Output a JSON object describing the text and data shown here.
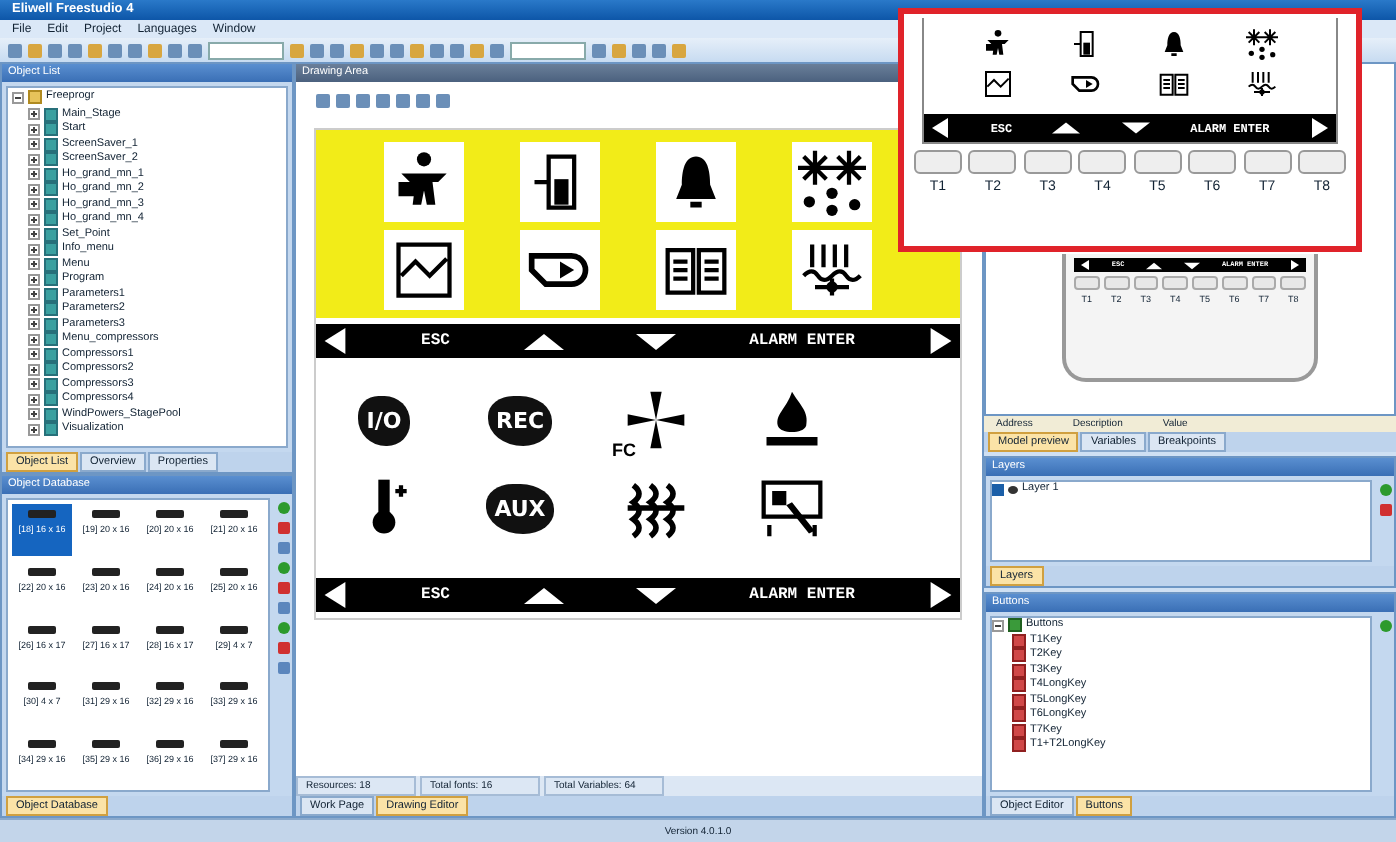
{
  "window": {
    "title": "Eliwell Freestudio 4"
  },
  "menu": [
    "File",
    "Edit",
    "Project",
    "Languages",
    "Window"
  ],
  "object_list": {
    "title": "Object List",
    "root": {
      "label": "Freeprogr",
      "expanded": true,
      "children": [
        {
          "label": "Main_Stage"
        },
        {
          "label": "Start"
        },
        {
          "label": "ScreenSaver_1"
        },
        {
          "label": "ScreenSaver_2"
        },
        {
          "label": "Ho_grand_mn_1"
        },
        {
          "label": "Ho_grand_mn_2"
        },
        {
          "label": "Ho_grand_mn_3"
        },
        {
          "label": "Ho_grand_mn_4"
        },
        {
          "label": "Set_Point"
        },
        {
          "label": "Info_menu"
        },
        {
          "label": "Menu"
        },
        {
          "label": "Program"
        },
        {
          "label": "Parameters1"
        },
        {
          "label": "Parameters2"
        },
        {
          "label": "Parameters3"
        },
        {
          "label": "Menu_compressors"
        },
        {
          "label": "Compressors1"
        },
        {
          "label": "Compressors2"
        },
        {
          "label": "Compressors3"
        },
        {
          "label": "Compressors4"
        },
        {
          "label": "WindPowers_StagePool"
        },
        {
          "label": "Visualization"
        }
      ]
    },
    "tabs": [
      {
        "label": "Object List",
        "selected": true
      },
      {
        "label": "Overview",
        "selected": false
      },
      {
        "label": "Properties",
        "selected": false
      }
    ]
  },
  "object_database": {
    "title": "Object Database",
    "items": [
      {
        "label": "[18] 16 x 16",
        "selected": true
      },
      {
        "label": "[19] 20 x 16",
        "selected": false
      },
      {
        "label": "[20] 20 x 16",
        "selected": false
      },
      {
        "label": "[21] 20 x 16",
        "selected": false
      },
      {
        "label": "[22] 20 x 16",
        "selected": false
      },
      {
        "label": "[23] 20 x 16",
        "selected": false
      },
      {
        "label": "[24] 20 x 16",
        "selected": false
      },
      {
        "label": "[25] 20 x 16",
        "selected": false
      },
      {
        "label": "[26] 16 x 17",
        "selected": false
      },
      {
        "label": "[27] 16 x 17",
        "selected": false
      },
      {
        "label": "[28] 16 x 17",
        "selected": false
      },
      {
        "label": "[29] 4 x 7",
        "selected": false
      },
      {
        "label": "[30] 4 x 7",
        "selected": false
      },
      {
        "label": "[31] 29 x 16",
        "selected": false
      },
      {
        "label": "[32] 29 x 16",
        "selected": false
      },
      {
        "label": "[33] 29 x 16",
        "selected": false
      },
      {
        "label": "[34] 29 x 16",
        "selected": false
      },
      {
        "label": "[35] 29 x 16",
        "selected": false
      },
      {
        "label": "[36] 29 x 16",
        "selected": false
      },
      {
        "label": "[37] 29 x 16",
        "selected": false
      }
    ],
    "tabs": [
      {
        "label": "Object Database",
        "selected": true
      }
    ]
  },
  "editor": {
    "title": "Drawing Area",
    "upper_icons": [
      {
        "kind": "person"
      },
      {
        "kind": "door"
      },
      {
        "kind": "bell"
      },
      {
        "kind": "snow"
      },
      {
        "kind": "chart"
      },
      {
        "kind": "horn"
      },
      {
        "kind": "book"
      },
      {
        "kind": "heater"
      }
    ],
    "nav_bars": [
      {
        "left": "ESC",
        "right": "ALARM ENTER"
      },
      {
        "left": "ESC",
        "right": "ALARM ENTER"
      }
    ],
    "lower_icons": [
      {
        "kind": "badge",
        "label": "I/O"
      },
      {
        "kind": "badge",
        "label": "REC"
      },
      {
        "kind": "fan",
        "label": "FC"
      },
      {
        "kind": "flame"
      },
      {
        "kind": "thermo"
      },
      {
        "kind": "badge",
        "label": "AUX"
      },
      {
        "kind": "coil"
      },
      {
        "kind": "tool"
      }
    ],
    "status": [
      "Resources: 18",
      "Total fonts: 16",
      "Total Variables: 64"
    ],
    "tabs": [
      {
        "label": "Work Page",
        "selected": false
      },
      {
        "label": "Drawing Editor",
        "selected": true
      }
    ]
  },
  "preview": {
    "nav": {
      "left": "ESC",
      "right": "ALARM ENTER"
    },
    "keys": [
      "T1",
      "T2",
      "T3",
      "T4",
      "T5",
      "T6",
      "T7",
      "T8"
    ],
    "columns": [
      "Address",
      "Description",
      "Value"
    ],
    "tabs": [
      {
        "label": "Model preview",
        "selected": true
      },
      {
        "label": "Variables",
        "selected": false
      },
      {
        "label": "Breakpoints",
        "selected": false
      }
    ]
  },
  "layers": {
    "title": "Layers",
    "items": [
      {
        "label": "Layer 1",
        "visible": true
      }
    ],
    "tabs": [
      {
        "label": "Layers",
        "selected": true
      }
    ]
  },
  "buttons": {
    "title": "Buttons",
    "root": {
      "label": "Buttons",
      "expanded": true,
      "children": [
        {
          "label": "T1Key"
        },
        {
          "label": "T2Key"
        },
        {
          "label": "T3Key"
        },
        {
          "label": "T4LongKey"
        },
        {
          "label": "T5LongKey"
        },
        {
          "label": "T6LongKey"
        },
        {
          "label": "T7Key"
        },
        {
          "label": "T1+T2LongKey"
        }
      ]
    },
    "tabs": [
      {
        "label": "Object Editor",
        "selected": false
      },
      {
        "label": "Buttons",
        "selected": true
      }
    ]
  },
  "inset": {
    "icons": [
      {
        "kind": "person"
      },
      {
        "kind": "door"
      },
      {
        "kind": "bell"
      },
      {
        "kind": "snow"
      },
      {
        "kind": "chart"
      },
      {
        "kind": "horn"
      },
      {
        "kind": "book"
      },
      {
        "kind": "heater"
      }
    ],
    "nav": {
      "left": "ESC",
      "right": "ALARM ENTER"
    },
    "keys": [
      "T1",
      "T2",
      "T3",
      "T4",
      "T5",
      "T6",
      "T7",
      "T8"
    ]
  },
  "status_bar": {
    "version": "Version 4.0.1.0"
  }
}
